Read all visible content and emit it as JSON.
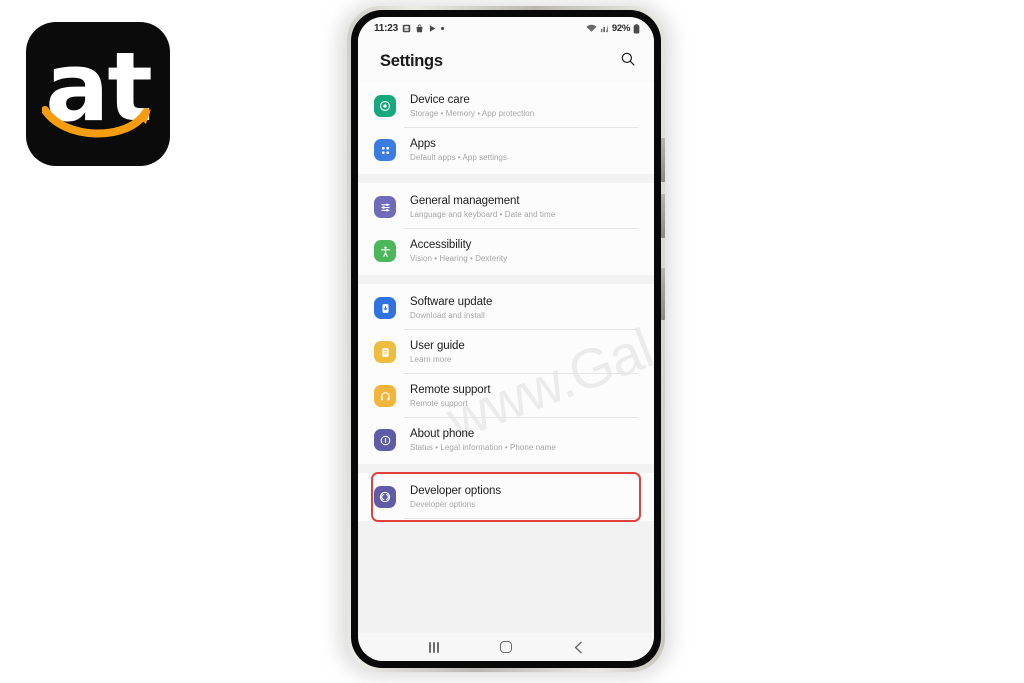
{
  "logo": {
    "text": "at",
    "background_color": "#0b0b0b",
    "smile_color": "#f59d0e",
    "icon_name": "at-amazon-logo"
  },
  "watermark": {
    "text": "www.Gal"
  },
  "phone": {
    "status_bar": {
      "time": "11:23",
      "left_icons": [
        "save-icon",
        "bag-icon",
        "play-store-icon",
        "dot-icon"
      ],
      "right_icons": [
        "wifi-icon",
        "signal-icon",
        "battery-icon"
      ],
      "battery_percent": "92%"
    },
    "header": {
      "title": "Settings",
      "search_icon": "search-icon"
    },
    "nav_bar": {
      "recents_label": "recents-icon",
      "home_label": "home-icon",
      "back_label": "back-icon"
    },
    "groups": [
      {
        "id": "group-device",
        "items": [
          {
            "title": "Device care",
            "subtitle": "Storage  •  Memory  •  App protection",
            "icon": "device-care-icon",
            "color": "#14a97c"
          },
          {
            "title": "Apps",
            "subtitle": "Default apps  •  App settings",
            "icon": "apps-grid-icon",
            "color": "#3b7ce0"
          }
        ]
      },
      {
        "id": "group-general",
        "items": [
          {
            "title": "General management",
            "subtitle": "Language and keyboard  •  Date and time",
            "icon": "sliders-icon",
            "color": "#6f6aba"
          },
          {
            "title": "Accessibility",
            "subtitle": "Vision  •  Hearing  •  Dexterity",
            "icon": "accessibility-icon",
            "color": "#4bb758"
          }
        ]
      },
      {
        "id": "group-support",
        "items": [
          {
            "title": "Software update",
            "subtitle": "Download and install",
            "icon": "software-update-icon",
            "color": "#2f72e0"
          },
          {
            "title": "User guide",
            "subtitle": "Learn more",
            "icon": "user-guide-icon",
            "color": "#f0bc3e"
          },
          {
            "title": "Remote support",
            "subtitle": "Remote support",
            "icon": "headphones-icon",
            "color": "#f2b63c"
          },
          {
            "title": "About phone",
            "subtitle": "Status  •  Legal information  •  Phone name",
            "icon": "info-icon",
            "color": "#5e5ba8"
          }
        ]
      },
      {
        "id": "group-developer",
        "highlighted": true,
        "highlight_color": "#e2403c",
        "items": [
          {
            "title": "Developer options",
            "subtitle": "Developer options",
            "icon": "developer-options-icon",
            "color": "#5e5ba8"
          }
        ]
      }
    ]
  }
}
